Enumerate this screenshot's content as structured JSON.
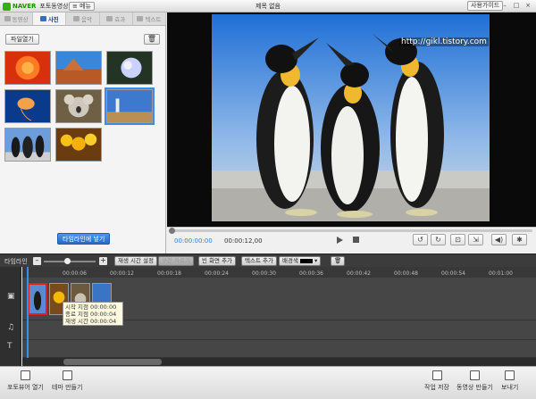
{
  "titlebar": {
    "logo": "NAVER",
    "app": "포토동영상",
    "menu": "메뉴",
    "title": "제목 없음",
    "guide": "사용가이드"
  },
  "tabs": [
    {
      "label": "동영상",
      "active": false
    },
    {
      "label": "사진",
      "active": true
    },
    {
      "label": "음악",
      "active": false
    },
    {
      "label": "효과",
      "active": false
    },
    {
      "label": "텍스트",
      "active": false
    }
  ],
  "panel": {
    "load_label": "파일열기",
    "add_timeline_label": "타임라인에 넣기"
  },
  "photos": [
    {
      "name": "chrysanthemum",
      "colors": [
        "#e33a10",
        "#ff8a2a"
      ]
    },
    {
      "name": "desert",
      "colors": [
        "#2f78c9",
        "#c46a2e"
      ]
    },
    {
      "name": "hydrangea",
      "colors": [
        "#2b3a2a",
        "#b9c6ff"
      ]
    },
    {
      "name": "jellyfish",
      "colors": [
        "#0d3c8a",
        "#f3a24b"
      ]
    },
    {
      "name": "koala",
      "colors": [
        "#6c5a3f",
        "#c9c1b2"
      ]
    },
    {
      "name": "lighthouse",
      "colors": [
        "#3a74c5",
        "#caa36a"
      ]
    },
    {
      "name": "penguins",
      "colors": [
        "#5a8ad0",
        "#d9d9d9"
      ]
    },
    {
      "name": "tulips",
      "colors": [
        "#f2b80a",
        "#7a4b1a"
      ]
    }
  ],
  "preview": {
    "watermark": "http://gikl.tistory.com",
    "time_current": "00:00:00:00",
    "time_total": "00:00:12,00"
  },
  "timeline": {
    "label": "타임라인",
    "buttons": {
      "play_time": "재생 시간 설정",
      "split": "구간 자르기",
      "empty": "빈 화면 추가",
      "text": "텍스트 추가",
      "bg": "배경색"
    },
    "ticks": [
      "00:00:06",
      "00:00:12",
      "00:00:18",
      "00:00:24",
      "00:00:30",
      "00:00:36",
      "00:00:42",
      "00:00:48",
      "00:00:54",
      "00:01:00"
    ],
    "tooltip": {
      "start": "시작 지점 00:00:00",
      "end": "종료 지점 00:00:04",
      "duration": "재생 시간 00:00:04"
    }
  },
  "bottom": {
    "left": [
      "포토뷰어 열기",
      "테마 만들기"
    ],
    "right": [
      "작업 저장",
      "동영상 만들기",
      "보내기"
    ]
  }
}
